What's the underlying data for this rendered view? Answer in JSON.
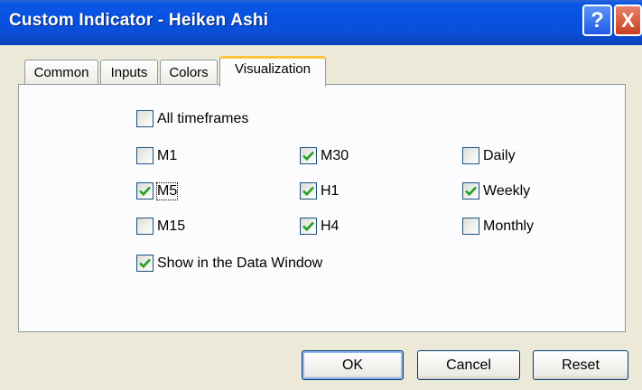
{
  "window": {
    "title": "Custom Indicator - Heiken Ashi",
    "help_glyph": "?",
    "close_glyph": "X"
  },
  "tabs": [
    {
      "label": "Common",
      "active": false
    },
    {
      "label": "Inputs",
      "active": false
    },
    {
      "label": "Colors",
      "active": false
    },
    {
      "label": "Visualization",
      "active": true
    }
  ],
  "visualization": {
    "all_timeframes": {
      "label": "All timeframes",
      "checked": false
    },
    "timeframes": [
      {
        "label": "M1",
        "checked": false
      },
      {
        "label": "M30",
        "checked": true
      },
      {
        "label": "Daily",
        "checked": false
      },
      {
        "label": "M5",
        "checked": true,
        "focused": true
      },
      {
        "label": "H1",
        "checked": true
      },
      {
        "label": "Weekly",
        "checked": true
      },
      {
        "label": "M15",
        "checked": false
      },
      {
        "label": "H4",
        "checked": true
      },
      {
        "label": "Monthly",
        "checked": false
      }
    ],
    "show_in_data_window": {
      "label": "Show in the Data Window",
      "checked": true
    }
  },
  "buttons": {
    "ok": "OK",
    "cancel": "Cancel",
    "reset": "Reset"
  },
  "colors": {
    "check_mark": "#21a121",
    "titlebar": "#0a57e6",
    "tab_highlight": "#ffc73c"
  }
}
